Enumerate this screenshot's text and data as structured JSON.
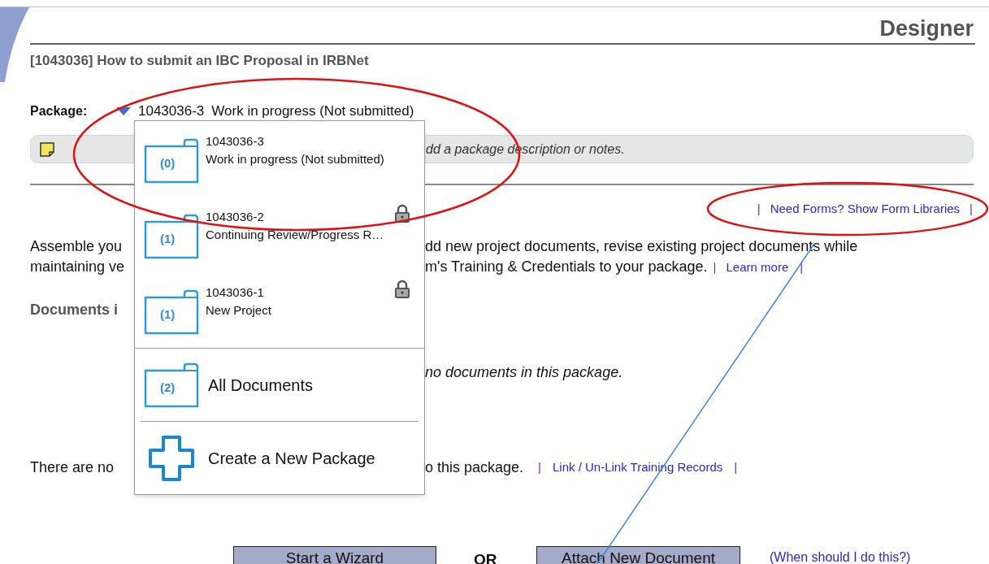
{
  "header": {
    "title": "Designer"
  },
  "project_title": "[1043036] How to submit an IBC Proposal in IRBNet",
  "package": {
    "label": "Package:",
    "number": "1043036-3",
    "status": "Work in progress (Not submitted)",
    "expanded": true
  },
  "note_bar": {
    "text": "dd a package description or notes."
  },
  "form_link": {
    "pipes": [
      "|",
      "|"
    ],
    "text": "Need Forms? Show Form Libraries"
  },
  "intro": {
    "line_1_start": "Assemble you",
    "line_1_end": "dd new project documents, revise existing project documents while",
    "line_2_start": "maintaining ve",
    "line_2_end": "m's Training & Credentials to your package.",
    "pipes": [
      "|",
      "|"
    ],
    "link": "Learn more"
  },
  "documents_heading": "Documents i",
  "empty_documents": "no documents in this package.",
  "training": {
    "start": "There are no",
    "end": "o this package.",
    "pipes": [
      "|",
      "|"
    ],
    "link": "Link / Un-Link Training Records"
  },
  "actions": {
    "primary": "Start a Wizard",
    "separator": "OR",
    "secondary": "Attach New Document",
    "help_link": "(When should I do this?)"
  },
  "package_menu": {
    "packages": [
      {
        "count": "(0)",
        "number": "1043036-3",
        "name": "Work in progress (Not submitted)",
        "locked": false
      },
      {
        "count": "(1)",
        "number": "1043036-2",
        "name": "Continuing Review/Progress R…",
        "locked": true
      },
      {
        "count": "(1)",
        "number": "1043036-1",
        "name": "New Project",
        "locked": true
      }
    ],
    "all_documents": {
      "count": "(2)",
      "label": "All Documents"
    },
    "create": "Create a New Package"
  }
}
